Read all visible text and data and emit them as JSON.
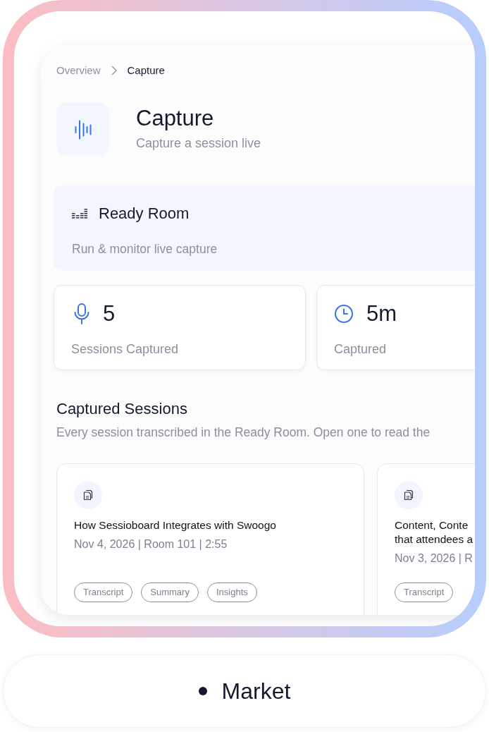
{
  "breadcrumb": [
    {
      "label": "Overview",
      "current": false
    },
    {
      "label": "Capture",
      "current": true
    }
  ],
  "header": {
    "title": "Capture",
    "subtitle": "Capture a session live"
  },
  "ready_room": {
    "title": "Ready Room",
    "description": "Run & monitor live capture"
  },
  "stats": [
    {
      "kind": "mic",
      "value": "5",
      "label": "Sessions Captured"
    },
    {
      "kind": "clock",
      "value": "5m",
      "label": "Captured"
    }
  ],
  "sessions_section": {
    "title": "Captured Sessions",
    "description": "Every session transcribed in the Ready Room. Open one to read the"
  },
  "sessions": [
    {
      "title_lines": [
        "How Sessioboard Integrates with Swoogo"
      ],
      "meta": "Nov 4, 2026 | Room 101 | 2:55",
      "tags": [
        "Transcript",
        "Summary",
        "Insights"
      ]
    },
    {
      "title_lines": [
        "Content, Conte",
        "that attendees a"
      ],
      "meta": "Nov 3, 2026 | R",
      "tags": [
        "Transcript"
      ]
    }
  ],
  "footer": {
    "label": "Market"
  }
}
